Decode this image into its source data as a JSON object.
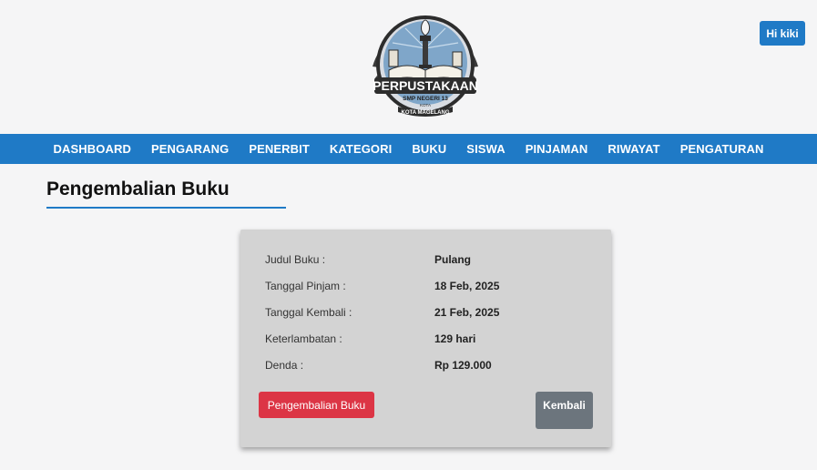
{
  "header": {
    "logo": {
      "title": "PERPUSTAKAAN",
      "line1": "SMP NEGERI 13",
      "line2": "KOTA",
      "line3": "KOTA MAGELANG"
    },
    "user_button": "Hi kiki"
  },
  "nav": {
    "items": [
      "DASHBOARD",
      "PENGARANG",
      "PENERBIT",
      "KATEGORI",
      "BUKU",
      "SISWA",
      "PINJAMAN",
      "RIWAYAT",
      "PENGATURAN"
    ]
  },
  "page": {
    "title": "Pengembalian Buku"
  },
  "details": {
    "rows": [
      {
        "label": "Judul Buku :",
        "value": "Pulang"
      },
      {
        "label": "Tanggal Pinjam :",
        "value": "18 Feb, 2025"
      },
      {
        "label": "Tanggal Kembali :",
        "value": "21 Feb, 2025"
      },
      {
        "label": "Keterlambatan :",
        "value": "129 hari"
      },
      {
        "label": "Denda :",
        "value": "Rp 129.000"
      }
    ]
  },
  "actions": {
    "return_label": "Pengembalian Buku",
    "back_label": "Kembali"
  },
  "colors": {
    "primary": "#1f7ac6",
    "danger": "#dc3545",
    "secondary": "#6c757d",
    "card_bg": "#d3d3d3",
    "page_bg": "#f5f5f6"
  }
}
